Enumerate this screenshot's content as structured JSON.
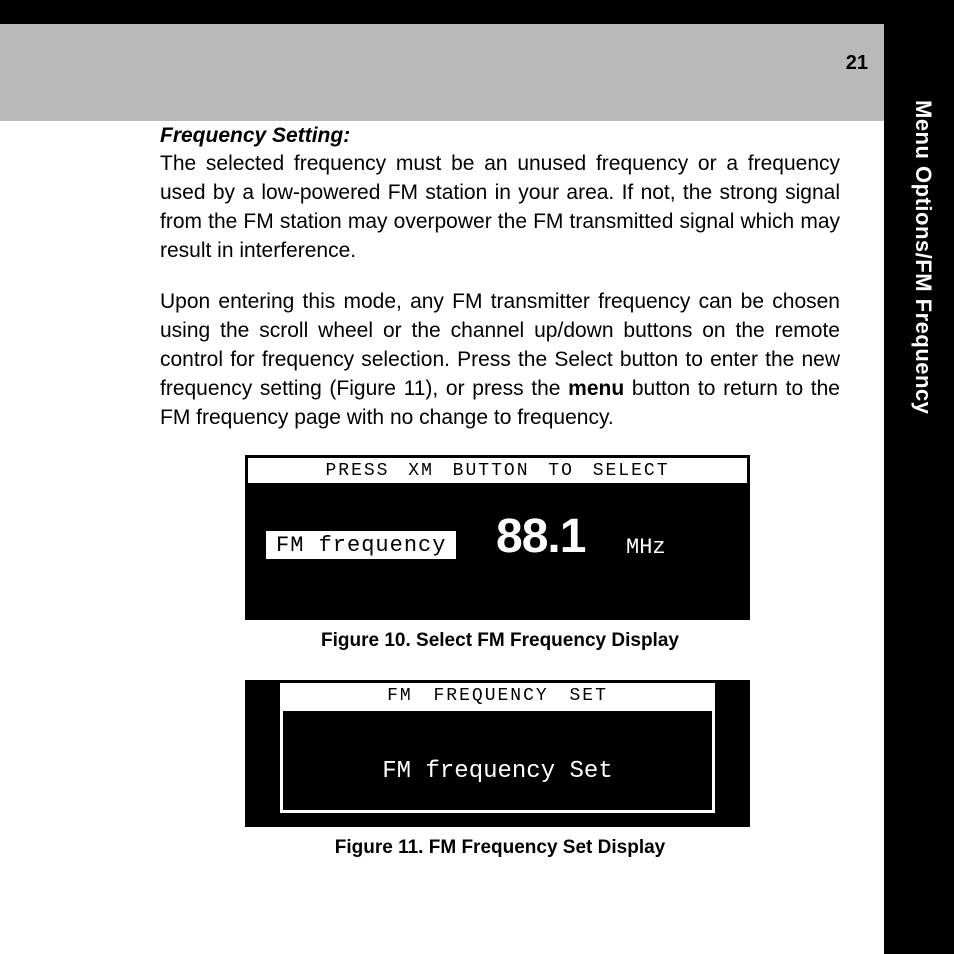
{
  "page_number": "21",
  "side_tab": "Menu Options/FM Frequency",
  "section_title": "Frequency Setting:",
  "paragraph1": "The selected frequency must be an unused frequency or a frequency used by a low-powered FM station in your area. If not, the strong signal from the FM station may overpower the FM transmitted signal which may result in interference.",
  "paragraph2_pre": "Upon entering this mode, any FM transmitter frequency can be chosen using the scroll wheel or the channel up/down buttons on the remote control for frequency selection. Press the Select button to enter the new frequency setting (Figure 11), or press the ",
  "paragraph2_bold": "menu",
  "paragraph2_post": " button to return to the FM frequency page with no change to frequency.",
  "figure10": {
    "topbar": "PRESS XM BUTTON TO SELECT",
    "label": "FM frequency",
    "value": "88.1",
    "unit": "MHz",
    "caption": "Figure 10. Select FM Frequency Display"
  },
  "figure11": {
    "topbar": "FM FREQUENCY SET",
    "message": "FM frequency Set",
    "caption": "Figure 11. FM Frequency Set Display"
  }
}
